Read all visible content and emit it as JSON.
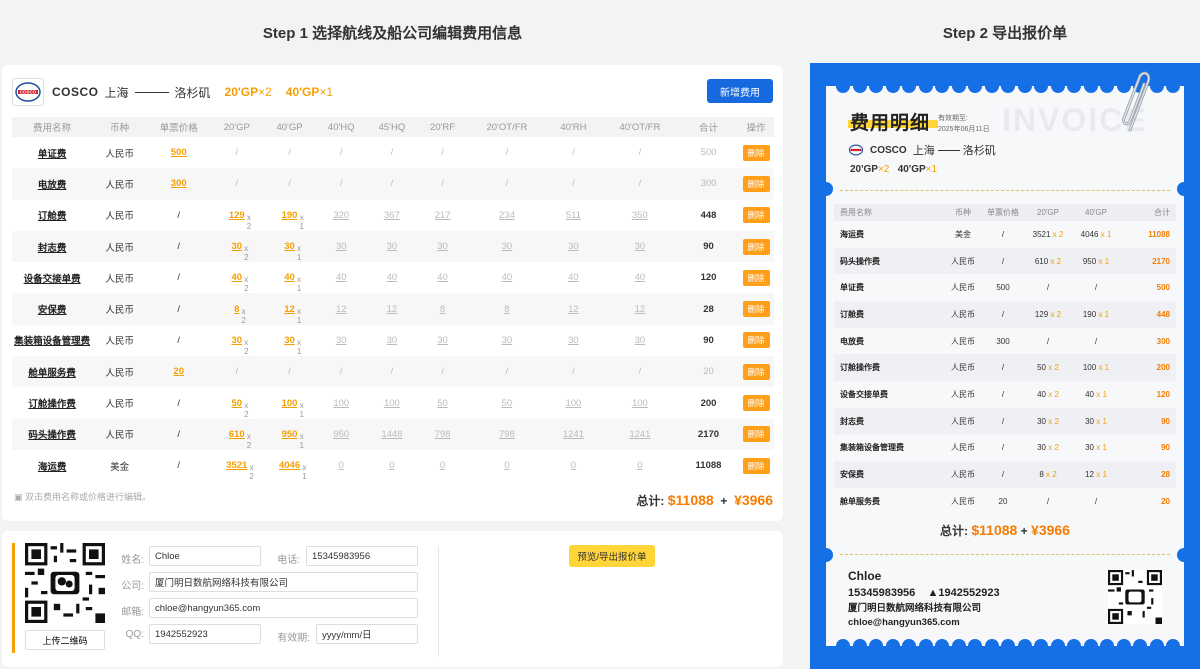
{
  "steps": {
    "step1": "Step 1  选择航线及船公司编辑费用信息",
    "step2": "Step 2  导出报价单"
  },
  "header": {
    "brand": "COSCO",
    "from": "上海",
    "to": "洛杉矶",
    "container1": "20'GP",
    "container1_x": "×2",
    "container2": "40'GP",
    "container2_x": "×1",
    "add_button": "新增费用"
  },
  "fee_table": {
    "columns": [
      "费用名称",
      "币种",
      "单票价格",
      "20'GP",
      "40'GP",
      "40'HQ",
      "45'HQ",
      "20'RF",
      "20'OT/FR",
      "40'RH",
      "40'OT/FR",
      "合计",
      "操作"
    ],
    "delete_label": "删除",
    "rows": [
      {
        "name": "单证费",
        "currency": "人民币",
        "ticket": "500",
        "gp20": "/",
        "gp40": "/",
        "hq40": "/",
        "hq45": "/",
        "rf20": "/",
        "ot20": "/",
        "rh40": "/",
        "ot40": "/",
        "total": "500",
        "total_active": false
      },
      {
        "name": "电放费",
        "currency": "人民币",
        "ticket": "300",
        "gp20": "/",
        "gp40": "/",
        "hq40": "/",
        "hq45": "/",
        "rf20": "/",
        "ot20": "/",
        "rh40": "/",
        "ot40": "/",
        "total": "300",
        "total_active": false
      },
      {
        "name": "订舱费",
        "currency": "人民币",
        "ticket": "/",
        "gp20": "129",
        "gp40": "190",
        "hq40": "320",
        "hq45": "367",
        "rf20": "217",
        "ot20": "234",
        "rh40": "511",
        "ot40": "350",
        "total": "448",
        "total_active": true
      },
      {
        "name": "封志费",
        "currency": "人民币",
        "ticket": "/",
        "gp20": "30",
        "gp40": "30",
        "hq40": "30",
        "hq45": "30",
        "rf20": "30",
        "ot20": "30",
        "rh40": "30",
        "ot40": "30",
        "total": "90",
        "total_active": true
      },
      {
        "name": "设备交接单费",
        "currency": "人民币",
        "ticket": "/",
        "gp20": "40",
        "gp40": "40",
        "hq40": "40",
        "hq45": "40",
        "rf20": "40",
        "ot20": "40",
        "rh40": "40",
        "ot40": "40",
        "total": "120",
        "total_active": true
      },
      {
        "name": "安保费",
        "currency": "人民币",
        "ticket": "/",
        "gp20": "8",
        "gp40": "12",
        "hq40": "12",
        "hq45": "12",
        "rf20": "8",
        "ot20": "8",
        "rh40": "12",
        "ot40": "12",
        "total": "28",
        "total_active": true
      },
      {
        "name": "集装箱设备管理费",
        "currency": "人民币",
        "ticket": "/",
        "gp20": "30",
        "gp40": "30",
        "hq40": "30",
        "hq45": "30",
        "rf20": "30",
        "ot20": "30",
        "rh40": "30",
        "ot40": "30",
        "total": "90",
        "total_active": true
      },
      {
        "name": "舱单服务费",
        "currency": "人民币",
        "ticket": "20",
        "gp20": "/",
        "gp40": "/",
        "hq40": "/",
        "hq45": "/",
        "rf20": "/",
        "ot20": "/",
        "rh40": "/",
        "ot40": "/",
        "total": "20",
        "total_active": false
      },
      {
        "name": "订舱操作费",
        "currency": "人民币",
        "ticket": "/",
        "gp20": "50",
        "gp40": "100",
        "hq40": "100",
        "hq45": "100",
        "rf20": "50",
        "ot20": "50",
        "rh40": "100",
        "ot40": "100",
        "total": "200",
        "total_active": true
      },
      {
        "name": "码头操作费",
        "currency": "人民币",
        "ticket": "/",
        "gp20": "610",
        "gp40": "950",
        "hq40": "950",
        "hq45": "1448",
        "rf20": "798",
        "ot20": "798",
        "rh40": "1241",
        "ot40": "1241",
        "total": "2170",
        "total_active": true
      },
      {
        "name": "海运费",
        "currency": "美金",
        "ticket": "/",
        "gp20": "3521",
        "gp40": "4046",
        "hq40": "0",
        "hq45": "0",
        "rf20": "0",
        "ot20": "0",
        "rh40": "0",
        "ot40": "0",
        "total": "11088",
        "total_active": true
      }
    ],
    "mult20": "x 2",
    "mult40": "x 1",
    "hint": "双击费用名称或价格进行编辑。",
    "total_label": "总计:",
    "total_usd": "$11088",
    "plus": "+",
    "total_cny": "¥3966"
  },
  "contact_form": {
    "upload_label": "上传二维码",
    "name_label": "姓名:",
    "name_value": "Chloe",
    "phone_label": "电话:",
    "phone_value": "15345983956",
    "company_label": "公司:",
    "company_value": "厦门明日数航网络科技有限公司",
    "email_label": "邮箱:",
    "email_value": "chloe@hangyun365.com",
    "qq_label": "QQ:",
    "qq_value": "1942552923",
    "valid_label": "有效期:",
    "valid_placeholder": "yyyy/mm/日",
    "export_button": "预览/导出报价单"
  },
  "invoice": {
    "title": "费用明细",
    "watermark": "INVOICE",
    "date_label": "有效期至:",
    "date": "2025年06月11日",
    "brand": "COSCO",
    "from": "上海",
    "to": "洛杉矶",
    "container1": "20'GP",
    "container1_x": "×2",
    "container2": "40'GP",
    "container2_x": "×1",
    "columns": [
      "费用名称",
      "币种",
      "单票价格",
      "20'GP",
      "40'GP",
      "合计"
    ],
    "rows": [
      {
        "name": "海运费",
        "currency": "美金",
        "ticket": "/",
        "gp20": "3521",
        "gp40": "4046",
        "total": "11088"
      },
      {
        "name": "码头操作费",
        "currency": "人民币",
        "ticket": "/",
        "gp20": "610",
        "gp40": "950",
        "total": "2170"
      },
      {
        "name": "单证费",
        "currency": "人民币",
        "ticket": "500",
        "gp20": "/",
        "gp40": "/",
        "total": "500"
      },
      {
        "name": "订舱费",
        "currency": "人民币",
        "ticket": "/",
        "gp20": "129",
        "gp40": "190",
        "total": "448"
      },
      {
        "name": "电放费",
        "currency": "人民币",
        "ticket": "300",
        "gp20": "/",
        "gp40": "/",
        "total": "300"
      },
      {
        "name": "订舱操作费",
        "currency": "人民币",
        "ticket": "/",
        "gp20": "50",
        "gp40": "100",
        "total": "200"
      },
      {
        "name": "设备交接单费",
        "currency": "人民币",
        "ticket": "/",
        "gp20": "40",
        "gp40": "40",
        "total": "120"
      },
      {
        "name": "封志费",
        "currency": "人民币",
        "ticket": "/",
        "gp20": "30",
        "gp40": "30",
        "total": "90"
      },
      {
        "name": "集装箱设备管理费",
        "currency": "人民币",
        "ticket": "/",
        "gp20": "30",
        "gp40": "30",
        "total": "90"
      },
      {
        "name": "安保费",
        "currency": "人民币",
        "ticket": "/",
        "gp20": "8",
        "gp40": "12",
        "total": "28"
      },
      {
        "name": "舱单服务费",
        "currency": "人民币",
        "ticket": "20",
        "gp20": "/",
        "gp40": "/",
        "total": "20"
      }
    ],
    "mult20": "x 2",
    "mult40": "x 1",
    "total_label": "总计:",
    "total_usd": "$11088",
    "plus": "+",
    "total_cny": "¥3966",
    "contact_name": "Chloe",
    "contact_phone": "15345983956",
    "contact_qq": "1942552923",
    "contact_company": "厦门明日数航网络科技有限公司",
    "contact_email": "chloe@hangyun365.com"
  },
  "colors": {
    "accent_blue": "#1769e0",
    "accent_orange": "#f5a000",
    "total_orange": "#f57c00",
    "highlight_yellow": "#ffd53a"
  },
  "icons": {
    "logo": "cosco-logo-icon",
    "qr": "qr-code-icon",
    "wechat": "wechat-icon",
    "qq": "qq-penguin-icon",
    "clip": "paperclip-icon"
  }
}
